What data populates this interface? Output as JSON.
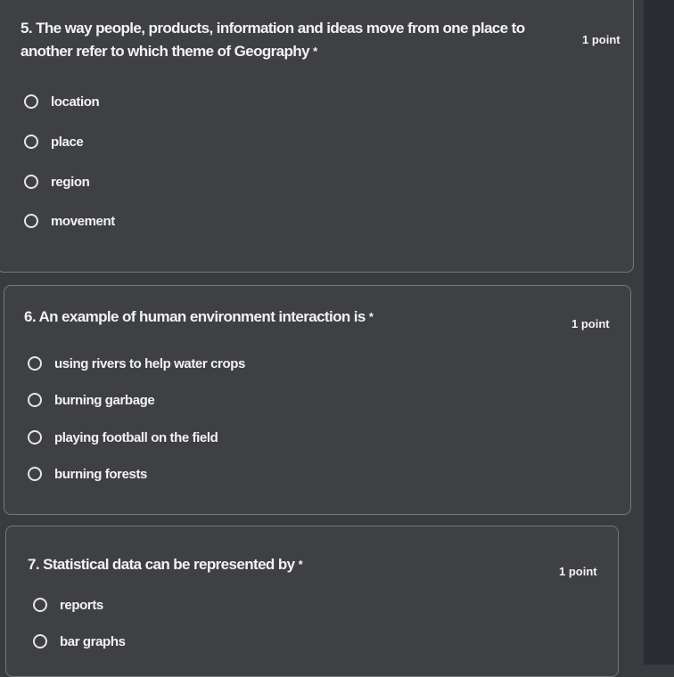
{
  "questions": [
    {
      "title": "5. The way people, products, information and ideas move from one place to",
      "title_cont": "another refer to which theme of Geography",
      "required": "*",
      "points": "1 point",
      "options": [
        "location",
        "place",
        "region",
        "movement"
      ]
    },
    {
      "title": "6. An example of human environment interaction is",
      "required": "*",
      "points": "1 point",
      "options": [
        "using rivers to help water crops",
        "burning garbage",
        "playing football on the field",
        "burning forests"
      ]
    },
    {
      "title": "7. Statistical data can be represented by",
      "required": "*",
      "points": "1 point",
      "options": [
        "reports",
        "bar graphs"
      ]
    }
  ],
  "colors": {
    "page_bg": "#3a3b3f",
    "card_bg": "#3f4044",
    "card_border": "#77787c",
    "text": "#f2f2f2"
  }
}
